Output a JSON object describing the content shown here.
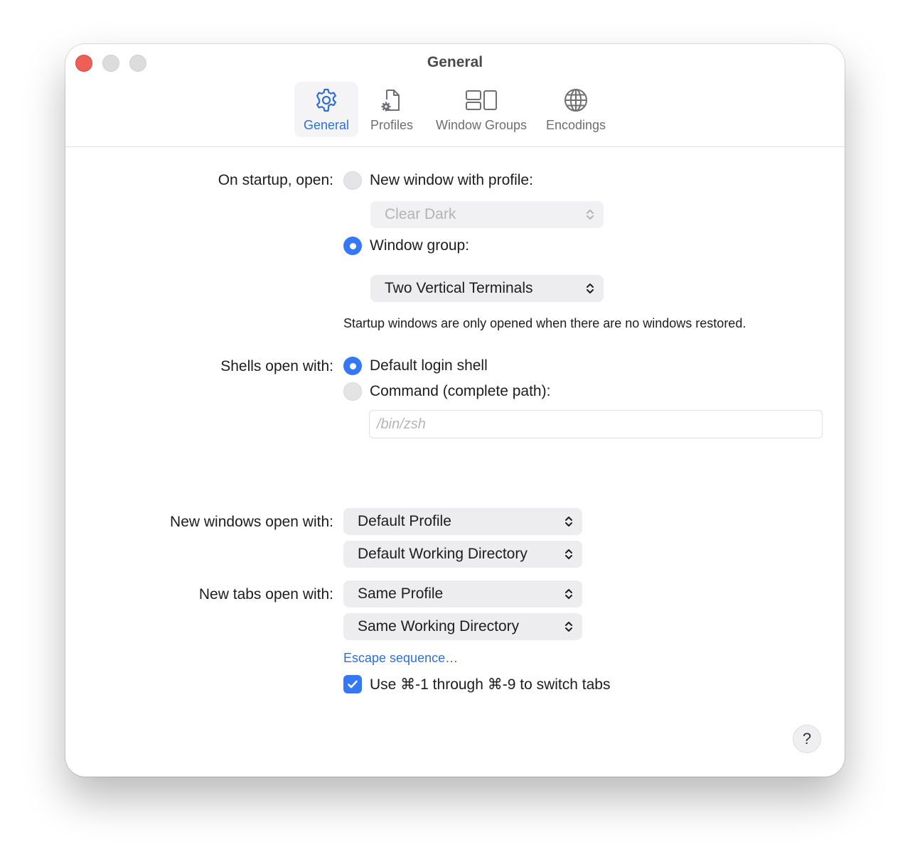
{
  "window": {
    "title": "General"
  },
  "toolbar": {
    "tabs": [
      {
        "label": "General",
        "icon": "gear-icon",
        "active": true
      },
      {
        "label": "Profiles",
        "icon": "profile-document-icon",
        "active": false
      },
      {
        "label": "Window Groups",
        "icon": "window-groups-icon",
        "active": false
      },
      {
        "label": "Encodings",
        "icon": "globe-icon",
        "active": false
      }
    ]
  },
  "startup": {
    "label": "On startup, open:",
    "option_new_window": "New window with profile:",
    "profile_select": "Clear Dark",
    "option_window_group": "Window group:",
    "group_select": "Two Vertical Terminals",
    "note": "Startup windows are only opened when there are no windows restored."
  },
  "shells": {
    "label": "Shells open with:",
    "option_default": "Default login shell",
    "option_command": "Command (complete path):",
    "command_placeholder": "/bin/zsh"
  },
  "new_windows": {
    "label": "New windows open with:",
    "profile_select": "Default Profile",
    "directory_select": "Default Working Directory"
  },
  "new_tabs": {
    "label": "New tabs open with:",
    "profile_select": "Same Profile",
    "directory_select": "Same Working Directory"
  },
  "escape_link": "Escape sequence…",
  "switch_tabs_checkbox": "Use ⌘-1 through ⌘-9 to switch tabs",
  "help_button": "?",
  "colors": {
    "accent": "#3478f6",
    "close": "#ee5f58",
    "link": "#2f6fd2"
  }
}
